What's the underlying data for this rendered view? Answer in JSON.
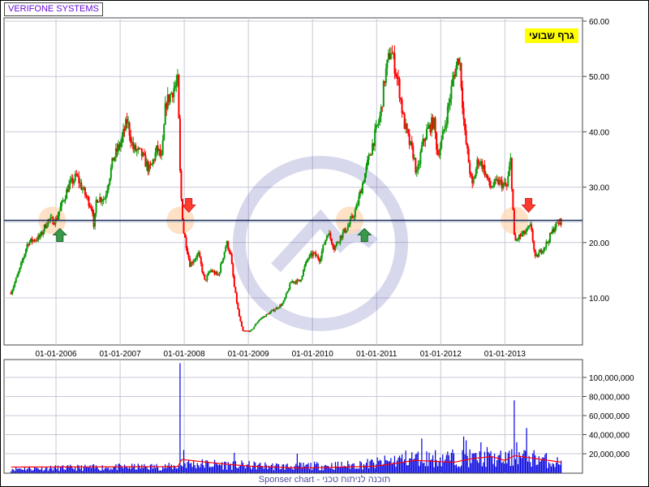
{
  "legend": "VERIFONE SYSTEMS",
  "badge": "גרף שבועי",
  "footer": "Sponser chart - תוכנה לניתוח טכני",
  "colors": {
    "up": "#0a9a0a",
    "down": "#ff0000",
    "grid": "#c8c8d8",
    "hline": "#1a2a5a",
    "volume": "#0000e0",
    "vol_ma": "#ff0000",
    "marker": "#ffd9b8"
  },
  "chart_data": [
    {
      "type": "candlestick",
      "title": "VERIFONE SYSTEMS",
      "ylim": [
        0,
        60
      ],
      "yticks": [
        10,
        20,
        30,
        40,
        50,
        60
      ],
      "ytick_labels": [
        "10.00",
        "20.00",
        "30.00",
        "40.00",
        "50.00",
        "60.00"
      ],
      "xlim": [
        2005.19,
        2014.21
      ],
      "xticks": [
        2006,
        2007,
        2008,
        2009,
        2010,
        2011,
        2012,
        2013
      ],
      "xtick_labels": [
        "01-01-2006",
        "01-01-2007",
        "01-01-2008",
        "01-01-2009",
        "01-01-2010",
        "01-01-2011",
        "01-01-2012",
        "01-01-2013"
      ],
      "horizontal_line": 24,
      "series": [
        [
          2005.3,
          11
        ],
        [
          2005.43,
          15
        ],
        [
          2005.56,
          20
        ],
        [
          2005.75,
          21
        ],
        [
          2005.87,
          24
        ],
        [
          2006.0,
          24
        ],
        [
          2006.06,
          26
        ],
        [
          2006.19,
          30
        ],
        [
          2006.32,
          32
        ],
        [
          2006.44,
          29
        ],
        [
          2006.57,
          26
        ],
        [
          2006.59,
          22
        ],
        [
          2006.63,
          28
        ],
        [
          2006.76,
          28
        ],
        [
          2006.89,
          35
        ],
        [
          2007.01,
          38
        ],
        [
          2007.11,
          42
        ],
        [
          2007.2,
          37
        ],
        [
          2007.33,
          36
        ],
        [
          2007.46,
          33
        ],
        [
          2007.58,
          37
        ],
        [
          2007.65,
          35
        ],
        [
          2007.71,
          45
        ],
        [
          2007.84,
          48
        ],
        [
          2007.9,
          49
        ],
        [
          2007.94,
          30
        ],
        [
          2007.99,
          22
        ],
        [
          2008.09,
          16
        ],
        [
          2008.22,
          18
        ],
        [
          2008.32,
          13
        ],
        [
          2008.41,
          15
        ],
        [
          2008.53,
          14
        ],
        [
          2008.66,
          20
        ],
        [
          2008.72,
          18
        ],
        [
          2008.78,
          12
        ],
        [
          2008.85,
          7
        ],
        [
          2008.91,
          4
        ],
        [
          2009.04,
          4
        ],
        [
          2009.16,
          6
        ],
        [
          2009.29,
          7
        ],
        [
          2009.42,
          8
        ],
        [
          2009.54,
          9
        ],
        [
          2009.67,
          13
        ],
        [
          2009.8,
          13
        ],
        [
          2009.92,
          17
        ],
        [
          2010.01,
          18
        ],
        [
          2010.11,
          17
        ],
        [
          2010.24,
          22
        ],
        [
          2010.34,
          19
        ],
        [
          2010.43,
          21
        ],
        [
          2010.56,
          23
        ],
        [
          2010.68,
          26
        ],
        [
          2010.81,
          32
        ],
        [
          2010.94,
          38
        ],
        [
          2011.06,
          43
        ],
        [
          2011.13,
          50
        ],
        [
          2011.22,
          55
        ],
        [
          2011.28,
          52
        ],
        [
          2011.35,
          48
        ],
        [
          2011.42,
          42
        ],
        [
          2011.51,
          38
        ],
        [
          2011.57,
          36
        ],
        [
          2011.63,
          32
        ],
        [
          2011.7,
          37
        ],
        [
          2011.78,
          40
        ],
        [
          2011.89,
          42
        ],
        [
          2011.95,
          36
        ],
        [
          2012.01,
          38
        ],
        [
          2012.11,
          44
        ],
        [
          2012.2,
          50
        ],
        [
          2012.29,
          54
        ],
        [
          2012.37,
          40
        ],
        [
          2012.43,
          35
        ],
        [
          2012.49,
          30
        ],
        [
          2012.58,
          35
        ],
        [
          2012.65,
          34
        ],
        [
          2012.77,
          30
        ],
        [
          2012.9,
          31
        ],
        [
          2013.03,
          30
        ],
        [
          2013.09,
          35
        ],
        [
          2013.15,
          20
        ],
        [
          2013.22,
          21
        ],
        [
          2013.34,
          22
        ],
        [
          2013.41,
          23
        ],
        [
          2013.47,
          17
        ],
        [
          2013.53,
          18
        ],
        [
          2013.66,
          20
        ],
        [
          2013.78,
          23
        ],
        [
          2013.89,
          24
        ]
      ],
      "signals": [
        {
          "type": "buy",
          "date": 2006.06,
          "price": 24
        },
        {
          "type": "sell",
          "date": 2008.07,
          "price": 24
        },
        {
          "type": "buy",
          "date": 2010.81,
          "price": 24
        },
        {
          "type": "sell",
          "date": 2013.37,
          "price": 24
        }
      ],
      "highlights": [
        [
          2005.94,
          24
        ],
        [
          2007.94,
          24
        ],
        [
          2010.58,
          24
        ],
        [
          2013.15,
          24
        ]
      ]
    },
    {
      "type": "bar",
      "title": "Volume",
      "ylim": [
        0,
        120000000
      ],
      "yticks": [
        20000000,
        40000000,
        60000000,
        80000000,
        100000000
      ],
      "ytick_labels": [
        "20,000,000",
        "40,000,000",
        "60,000,000",
        "80,000,000",
        "100,000,000"
      ],
      "baseline": [
        [
          2005.3,
          4000000
        ],
        [
          2007.9,
          6000000
        ],
        [
          2008.0,
          9000000
        ],
        [
          2009.5,
          6000000
        ],
        [
          2010.5,
          7000000
        ],
        [
          2011.0,
          9000000
        ],
        [
          2011.5,
          14000000
        ],
        [
          2012.3,
          14000000
        ],
        [
          2013.0,
          13000000
        ],
        [
          2013.3,
          16000000
        ],
        [
          2013.89,
          9000000
        ]
      ],
      "spikes": [
        [
          2007.94,
          115000000
        ],
        [
          2007.99,
          24000000
        ],
        [
          2008.79,
          21000000
        ],
        [
          2009.76,
          20000000
        ],
        [
          2011.71,
          36000000
        ],
        [
          2012.36,
          38000000
        ],
        [
          2012.39,
          34000000
        ],
        [
          2012.62,
          32000000
        ],
        [
          2012.72,
          27000000
        ],
        [
          2013.15,
          76000000
        ],
        [
          2013.18,
          32000000
        ],
        [
          2013.33,
          47000000
        ]
      ],
      "moving_average": [
        [
          2005.3,
          6000000
        ],
        [
          2007.9,
          6500000
        ],
        [
          2007.96,
          14000000
        ],
        [
          2008.5,
          10000000
        ],
        [
          2009.0,
          7000000
        ],
        [
          2009.8,
          5000000
        ],
        [
          2010.5,
          6000000
        ],
        [
          2011.0,
          7000000
        ],
        [
          2011.6,
          13000000
        ],
        [
          2012.2,
          11000000
        ],
        [
          2012.5,
          15000000
        ],
        [
          2012.8,
          17000000
        ],
        [
          2013.0,
          13000000
        ],
        [
          2013.15,
          18000000
        ],
        [
          2013.89,
          11000000
        ]
      ]
    }
  ]
}
